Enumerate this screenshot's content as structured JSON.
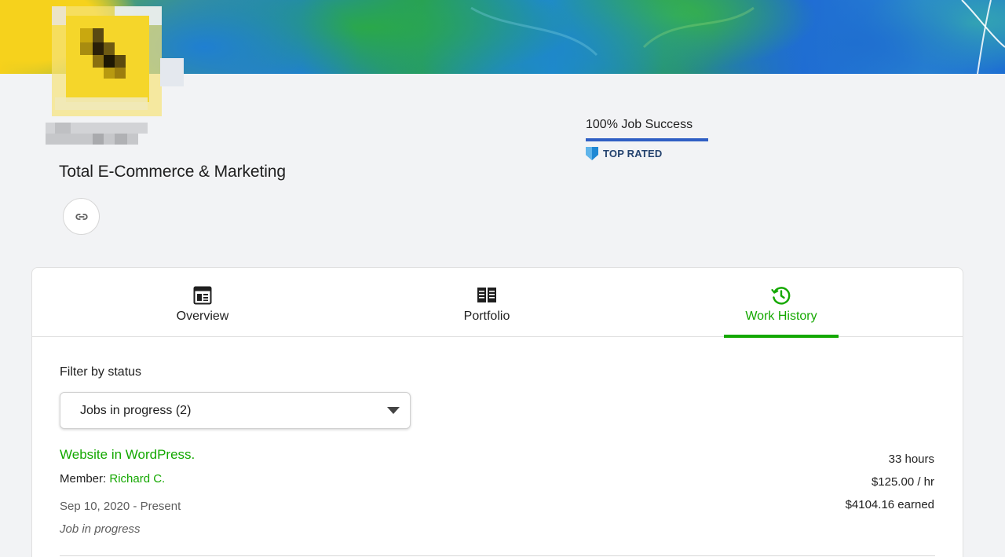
{
  "profile": {
    "company_name": "Total E-Commerce & Marketing",
    "job_success": "100% Job Success",
    "job_success_value": 100,
    "badge": "TOP RATED",
    "link_icon": "link-icon"
  },
  "tabs": [
    {
      "label": "Overview",
      "icon": "overview-icon",
      "active": false
    },
    {
      "label": "Portfolio",
      "icon": "book-icon",
      "active": false
    },
    {
      "label": "Work History",
      "icon": "history-clock-icon",
      "active": true
    }
  ],
  "filter": {
    "label": "Filter by status",
    "selected": "Jobs in progress (2)"
  },
  "jobs": [
    {
      "title": "Website in WordPress.",
      "member_prefix": "Member:",
      "member_name": "Richard C.",
      "dates": "Sep 10, 2020 - Present",
      "status": "Job in progress",
      "hours": "33 hours",
      "rate": "$125.00 / hr",
      "earned": "$4104.16 earned"
    }
  ],
  "colors": {
    "accent_green": "#14a800",
    "job_success_bar": "#2f5fc4",
    "badge_blue": "#1e88d4",
    "background": "#f2f3f5"
  }
}
